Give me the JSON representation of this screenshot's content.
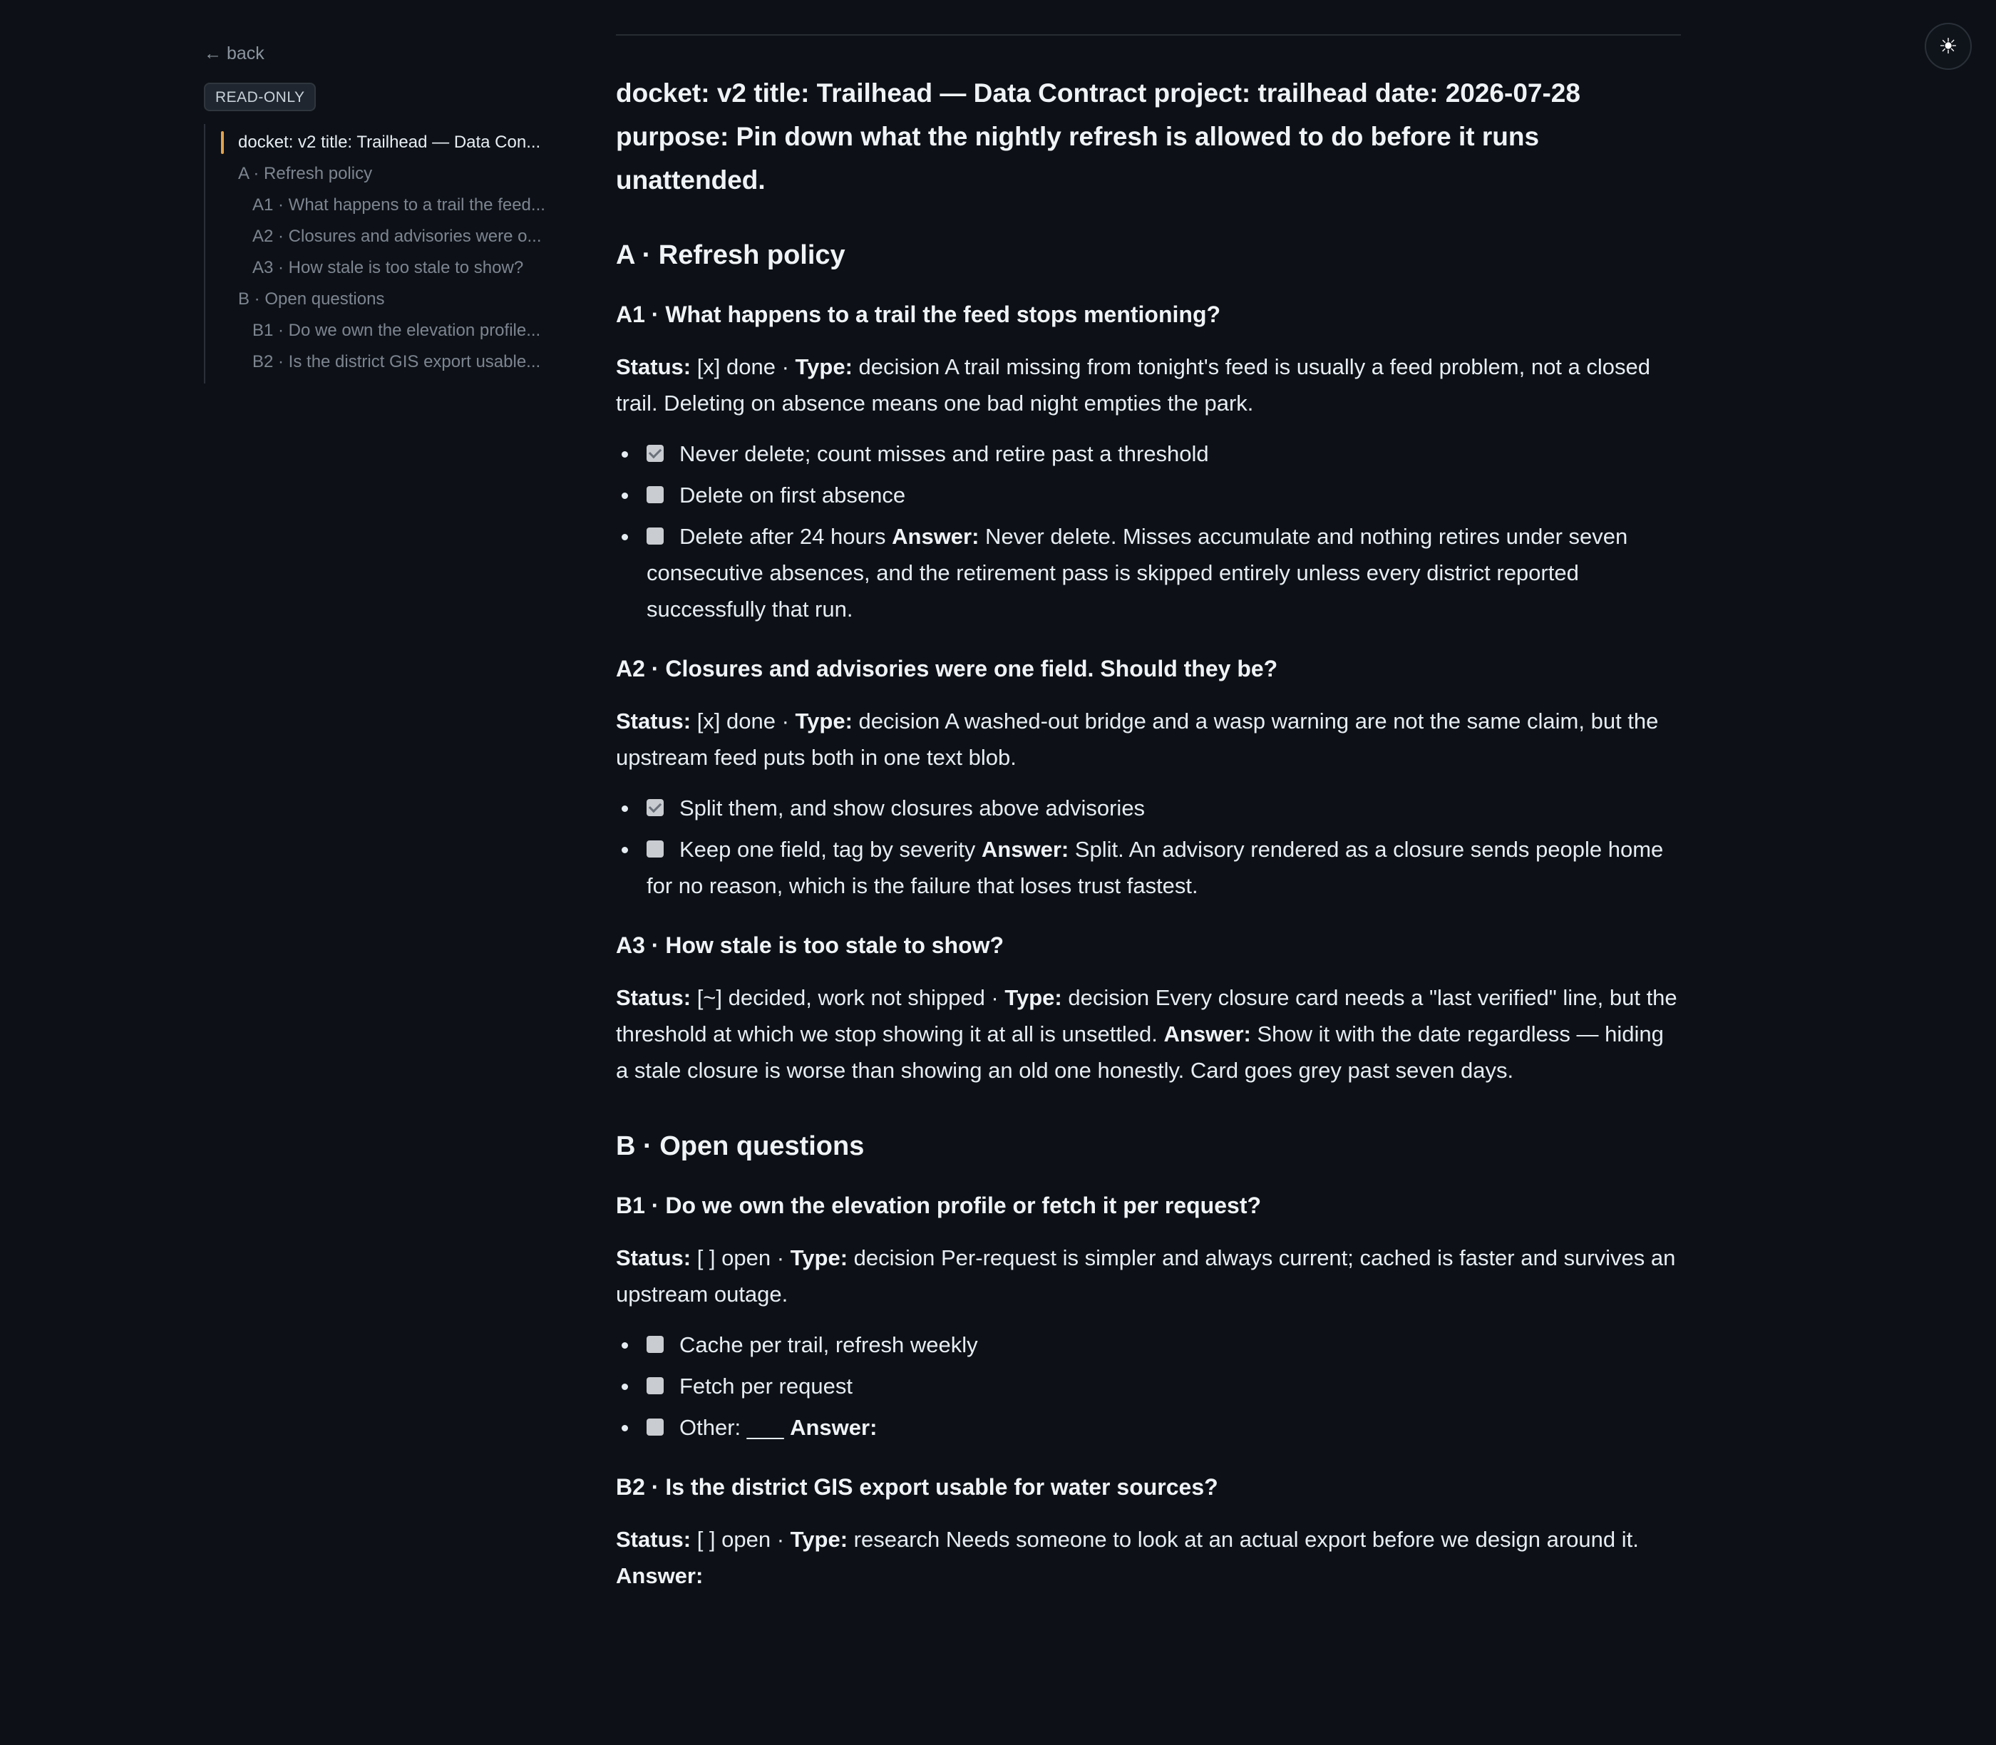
{
  "theme_toggle": {
    "icon": "☀"
  },
  "sidebar": {
    "back": "← back",
    "badge": "READ-ONLY",
    "toc": [
      "docket: v2 title: Trailhead — Data Con...",
      "A · Refresh policy",
      "A1 · What happens to a trail the feed...",
      "A2 · Closures and advisories were o...",
      "A3 · How stale is too stale to show?",
      "B · Open questions",
      "B1 · Do we own the elevation profile...",
      "B2 · Is the district GIS export usable..."
    ]
  },
  "doc": {
    "title": "docket: v2 title: Trailhead — Data Contract project: trailhead date: 2026-07-28 purpose: Pin down what the nightly refresh is allowed to do before it runs unattended.",
    "labels": {
      "status": "Status:",
      "type": "Type:",
      "answer": "Answer:"
    },
    "sectionA": {
      "heading": "A · Refresh policy",
      "a1": {
        "heading": "A1 · What happens to a trail the feed stops mentioning?",
        "status": " [x] done · ",
        "body": " decision A trail missing from tonight's feed is usually a feed problem, not a closed trail. Deleting on absence means one bad night empties the park.",
        "options": [
          "Never delete; count misses and retire past a threshold",
          "Delete on first absence",
          "Delete after 24 hours "
        ],
        "answer": " Never delete. Misses accumulate and nothing retires under seven consecutive absences, and the retirement pass is skipped entirely unless every district reported successfully that run."
      },
      "a2": {
        "heading": "A2 · Closures and advisories were one field. Should they be?",
        "status": " [x] done · ",
        "body": " decision A washed-out bridge and a wasp warning are not the same claim, but the upstream feed puts both in one text blob.",
        "options": [
          "Split them, and show closures above advisories",
          "Keep one field, tag by severity "
        ],
        "answer": " Split. An advisory rendered as a closure sends people home for no reason, which is the failure that loses trust fastest."
      },
      "a3": {
        "heading": "A3 · How stale is too stale to show?",
        "status": " [~] decided, work not shipped · ",
        "body": " decision Every closure card needs a \"last verified\" line, but the threshold at which we stop showing it at all is unsettled. ",
        "answer": " Show it with the date regardless — hiding a stale closure is worse than showing an old one honestly. Card goes grey past seven days."
      }
    },
    "sectionB": {
      "heading": "B · Open questions",
      "b1": {
        "heading": "B1 · Do we own the elevation profile or fetch it per request?",
        "status": " [ ] open · ",
        "body": " decision Per-request is simpler and always current; cached is faster and survives an upstream outage.",
        "options": [
          "Cache per trail, refresh weekly",
          "Fetch per request",
          "Other: ___ "
        ]
      },
      "b2": {
        "heading": "B2 · Is the district GIS export usable for water sources?",
        "status": " [ ] open · ",
        "body": " research Needs someone to look at an actual export before we design around it. "
      }
    }
  }
}
